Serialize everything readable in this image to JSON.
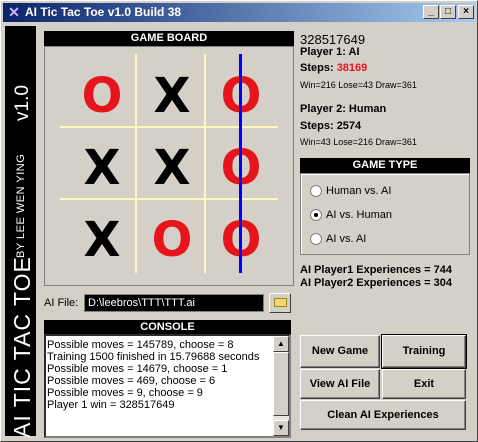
{
  "window": {
    "title": "AI Tic Tac Toe v1.0 Build 38",
    "controls": {
      "minimize": "_",
      "maximize": "□",
      "close": "×"
    }
  },
  "banner": {
    "version": "v1.0",
    "author": "BY LEE WEN YING",
    "name": "AI TIC TAC TOE"
  },
  "board": {
    "title": "GAME BOARD",
    "cells": [
      "O",
      "X",
      "O",
      "X",
      "X",
      "O",
      "X",
      "O",
      "O"
    ],
    "winning_line": "column-3",
    "colors": {
      "x": "#000000",
      "o": "#e8141c",
      "win_line": "#0000ff",
      "grid": "#fff8c0"
    }
  },
  "ai_file": {
    "label": "AI File:",
    "value": "D:\\leebros\\TTT\\TTT.ai",
    "browse_icon": "folder-icon"
  },
  "console": {
    "title": "CONSOLE",
    "lines": [
      "Possible moves = 145789, choose = 8",
      "Training 1500 finished in 15.79688 seconds",
      "Possible moves = 14679, choose = 1",
      "Possible moves = 469, choose = 6",
      "Possible moves = 9, choose = 9",
      "Player 1 win = 328517649"
    ]
  },
  "stats": {
    "total": "328517649",
    "player1": {
      "label": "Player 1:  AI",
      "steps_label": "Steps:",
      "steps": "38169",
      "record": "Win=216 Lose=43 Draw=361"
    },
    "player2": {
      "label": "Player 2:  Human",
      "steps_label": "Steps:",
      "steps": "2574",
      "record": "Win=43 Lose=216 Draw=361"
    }
  },
  "game_type": {
    "title": "GAME TYPE",
    "options": [
      {
        "label": "Human vs. AI",
        "checked": false
      },
      {
        "label": "AI vs. Human",
        "checked": true
      },
      {
        "label": "AI vs. AI",
        "checked": false
      }
    ]
  },
  "experiences": {
    "p1": "AI Player1 Experiences = 744",
    "p2": "AI Player2 Experiences = 304"
  },
  "buttons": {
    "new_game": "New Game",
    "training": "Training",
    "view_ai_file": "View AI File",
    "exit": "Exit",
    "clean": "Clean AI Experiences"
  }
}
